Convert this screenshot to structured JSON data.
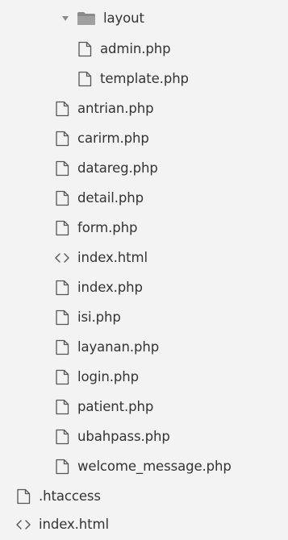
{
  "folder": {
    "name": "layout",
    "expanded": true,
    "icon": "folder-icon",
    "children": [
      {
        "name": "admin.php",
        "icon": "file-icon"
      },
      {
        "name": "template.php",
        "icon": "file-icon"
      }
    ]
  },
  "files": [
    {
      "name": "antrian.php",
      "icon": "file-icon"
    },
    {
      "name": "carirm.php",
      "icon": "file-icon"
    },
    {
      "name": "datareg.php",
      "icon": "file-icon"
    },
    {
      "name": "detail.php",
      "icon": "file-icon"
    },
    {
      "name": "form.php",
      "icon": "file-icon"
    },
    {
      "name": "index.html",
      "icon": "code-icon"
    },
    {
      "name": "index.php",
      "icon": "file-icon"
    },
    {
      "name": "isi.php",
      "icon": "file-icon"
    },
    {
      "name": "layanan.php",
      "icon": "file-icon"
    },
    {
      "name": "login.php",
      "icon": "file-icon"
    },
    {
      "name": "patient.php",
      "icon": "file-icon"
    },
    {
      "name": "ubahpass.php",
      "icon": "file-icon"
    },
    {
      "name": "welcome_message.php",
      "icon": "file-icon"
    }
  ],
  "root_files": [
    {
      "name": ".htaccess",
      "icon": "file-icon"
    },
    {
      "name": "index.html",
      "icon": "code-icon"
    }
  ],
  "colors": {
    "background": "#f3f3f3",
    "text": "#333333",
    "icon_stroke": "#555555",
    "folder_fill": "#8a8a8a"
  }
}
